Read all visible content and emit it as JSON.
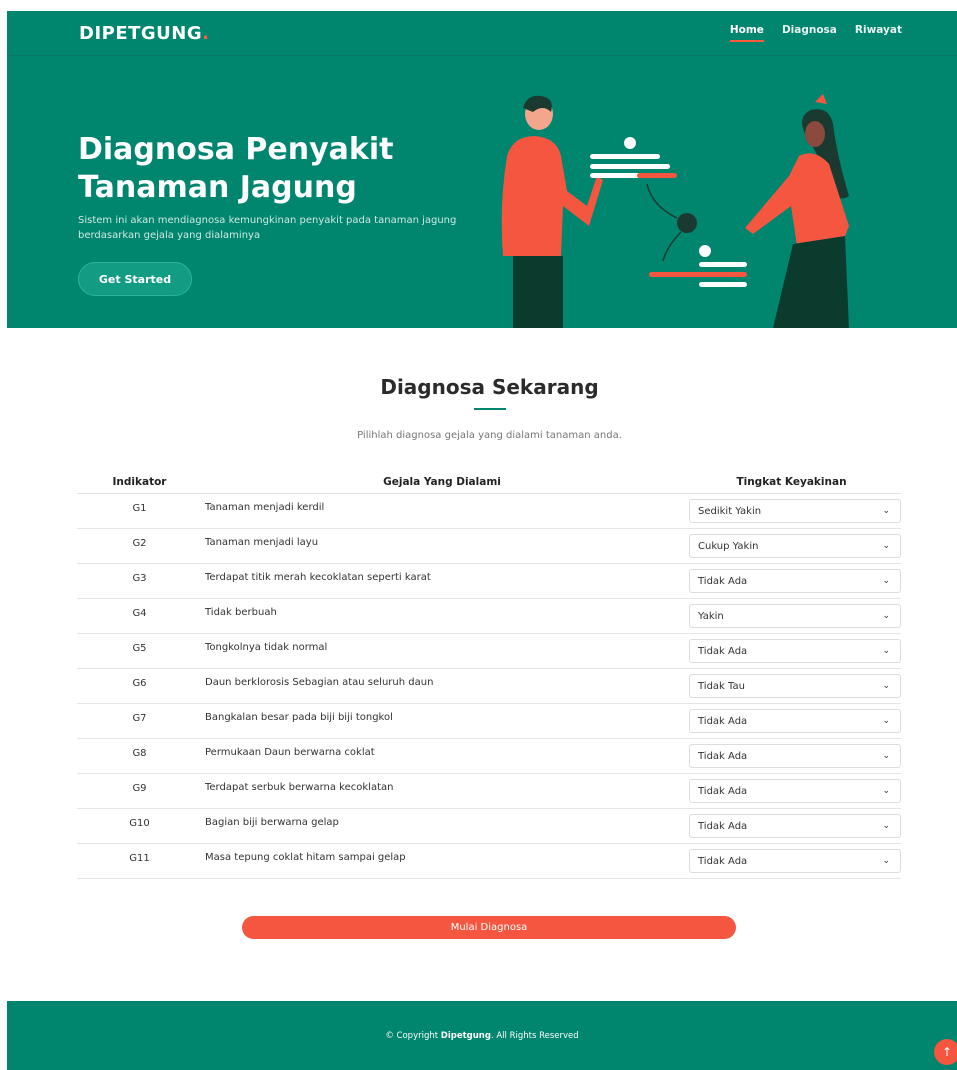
{
  "header": {
    "logo_text": "DIPETGUNG",
    "logo_dot": ".",
    "nav": [
      {
        "label": "Home",
        "active": true
      },
      {
        "label": "Diagnosa",
        "active": false
      },
      {
        "label": "Riwayat",
        "active": false
      }
    ]
  },
  "hero": {
    "title_line1": "Diagnosa Penyakit",
    "title_line2": "Tanaman Jagung",
    "description_line1": "Sistem ini akan mendiagnosa kemungkinan penyakit pada tanaman jagung",
    "description_line2": "berdasarkan gejala yang dialaminya",
    "cta_label": "Get Started"
  },
  "section": {
    "title": "Diagnosa Sekarang",
    "subtitle": "Pilihlah diagnosa gejala yang dialami tanaman anda."
  },
  "table": {
    "headers": [
      "Indikator",
      "Gejala Yang Dialami",
      "Tingkat Keyakinan"
    ],
    "rows": [
      {
        "code": "G1",
        "symptom": "Tanaman menjadi kerdil",
        "confidence": "Sedikit Yakin"
      },
      {
        "code": "G2",
        "symptom": "Tanaman menjadi layu",
        "confidence": "Cukup Yakin"
      },
      {
        "code": "G3",
        "symptom": "Terdapat titik merah kecoklatan seperti karat",
        "confidence": "Tidak Ada"
      },
      {
        "code": "G4",
        "symptom": "Tidak berbuah",
        "confidence": "Yakin"
      },
      {
        "code": "G5",
        "symptom": "Tongkolnya tidak normal",
        "confidence": "Tidak Ada"
      },
      {
        "code": "G6",
        "symptom": "Daun berklorosis Sebagian atau seluruh daun",
        "confidence": "Tidak Tau"
      },
      {
        "code": "G7",
        "symptom": "Bangkalan besar pada biji biji tongkol",
        "confidence": "Tidak Ada"
      },
      {
        "code": "G8",
        "symptom": "Permukaan Daun berwarna coklat",
        "confidence": "Tidak Ada"
      },
      {
        "code": "G9",
        "symptom": "Terdapat serbuk berwarna kecoklatan",
        "confidence": "Tidak Ada"
      },
      {
        "code": "G10",
        "symptom": "Bagian biji berwarna gelap",
        "confidence": "Tidak Ada"
      },
      {
        "code": "G11",
        "symptom": "Masa tepung coklat hitam sampai gelap",
        "confidence": "Tidak Ada"
      }
    ]
  },
  "submit_label": "Mulai Diagnosa",
  "footer": {
    "prefix": "© Copyright ",
    "brand": "Dipetgung",
    "suffix": ". All Rights Reserved"
  },
  "back_to_top_icon": "arrow-up-icon",
  "colors": {
    "primary": "#00856f",
    "accent": "#f4563f"
  }
}
